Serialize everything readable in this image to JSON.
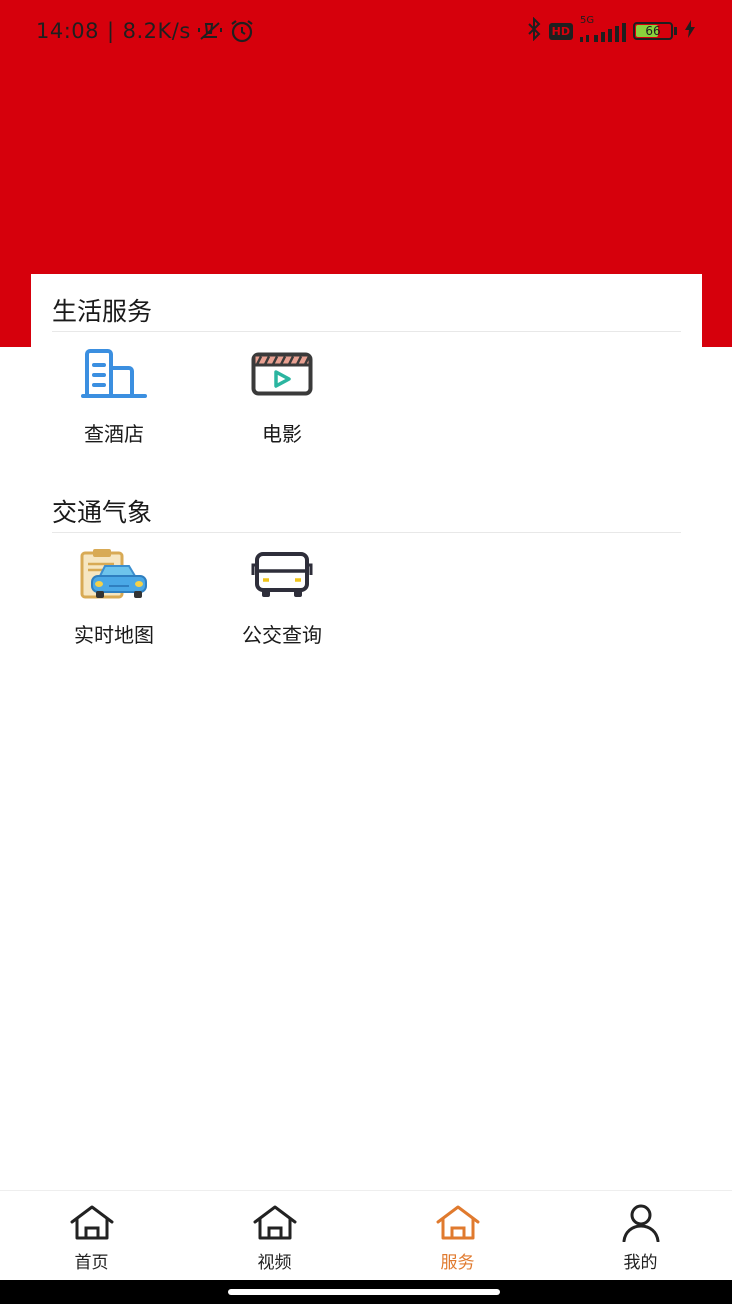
{
  "status_bar": {
    "time": "14:08",
    "separator": "|",
    "net_speed": "8.2K/s",
    "battery": "66",
    "network_label": "5G",
    "hd_label": "HD"
  },
  "sections": [
    {
      "title": "生活服务",
      "items": [
        {
          "label": "查酒店",
          "icon": "hotel-building-icon"
        },
        {
          "label": "电影",
          "icon": "movie-clapper-icon"
        }
      ]
    },
    {
      "title": "交通气象",
      "items": [
        {
          "label": "实时地图",
          "icon": "car-clipboard-icon"
        },
        {
          "label": "公交查询",
          "icon": "bus-icon"
        }
      ]
    }
  ],
  "bottom_nav": {
    "items": [
      {
        "label": "首页",
        "icon": "home-icon"
      },
      {
        "label": "视频",
        "icon": "home-icon"
      },
      {
        "label": "服务",
        "icon": "home-icon"
      },
      {
        "label": "我的",
        "icon": "user-icon"
      }
    ],
    "active_index": 2
  },
  "colors": {
    "header": "#d6000c",
    "active_tab": "#e07a2e",
    "hotel_icon": "#3b8fe0",
    "movie_play": "#2bb5a0"
  }
}
